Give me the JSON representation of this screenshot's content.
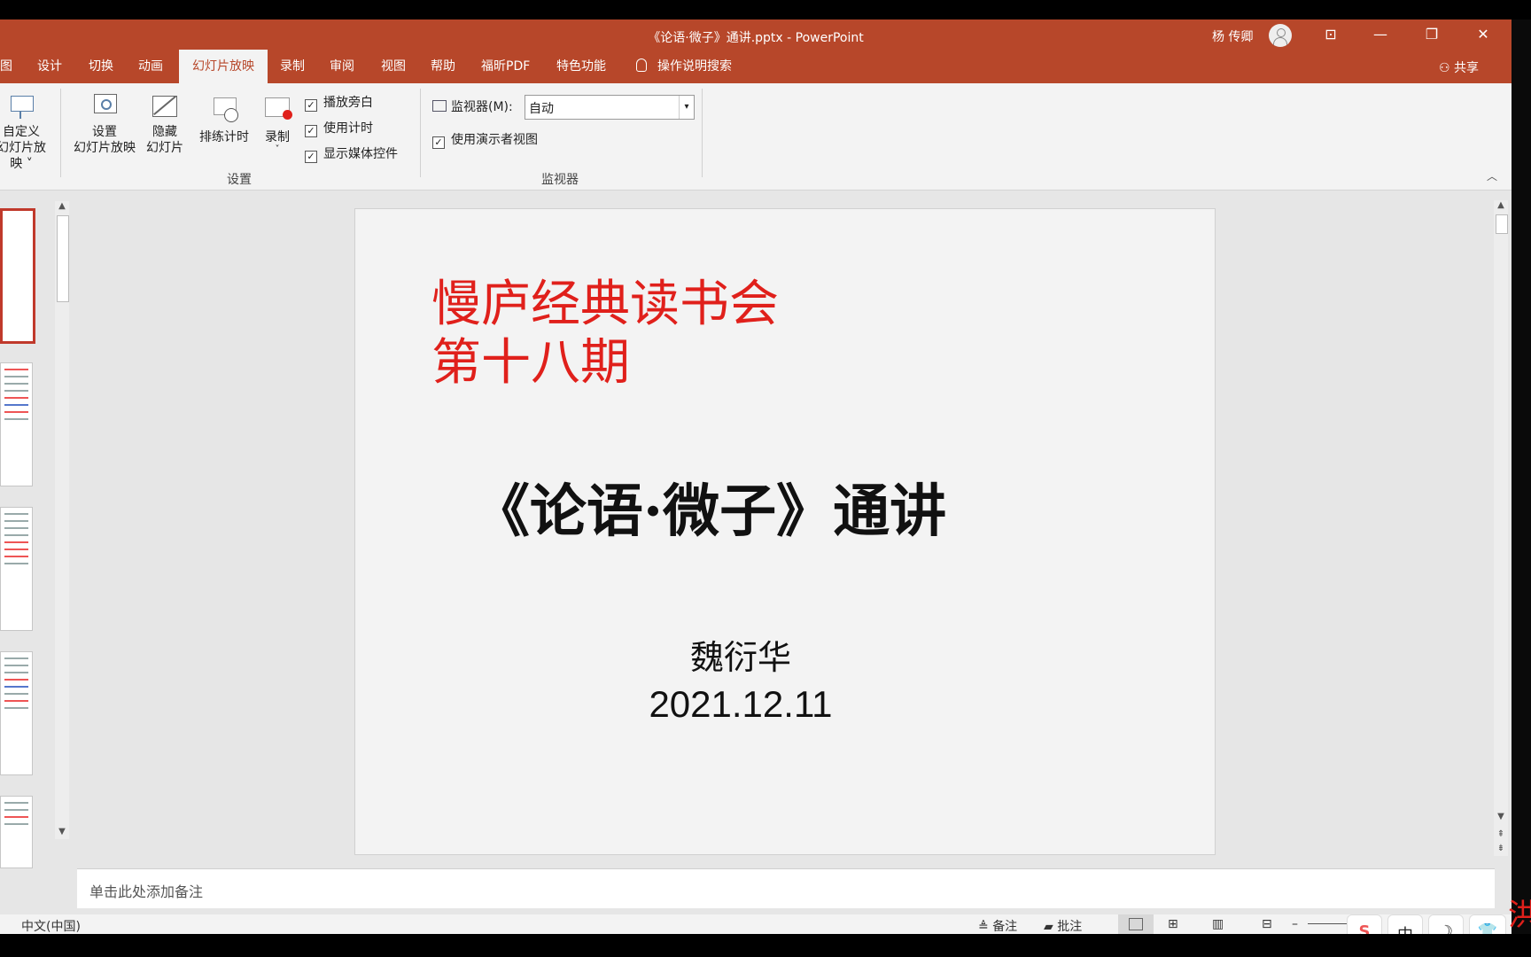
{
  "window": {
    "title": "《论语·微子》通讲.pptx  -  PowerPoint",
    "user": "杨 传卿",
    "controls": {
      "ribbon_display": "⊡",
      "minimize": "—",
      "restore": "❐",
      "close": "✕"
    }
  },
  "tabs": [
    "图",
    "设计",
    "切换",
    "动画",
    "幻灯片放映",
    "录制",
    "审阅",
    "视图",
    "帮助",
    "福昕PDF",
    "特色功能",
    "操作说明搜索"
  ],
  "share_label": "共享",
  "ribbon": {
    "custom_show": {
      "line1": "自定义",
      "line2": "幻灯片放映 ˅"
    },
    "setup": {
      "line1": "设置",
      "line2": "幻灯片放映"
    },
    "hide": {
      "line1": "隐藏",
      "line2": "幻灯片"
    },
    "rehearse": "排练计时",
    "record": {
      "label": "录制",
      "chev": "˅"
    },
    "checks": [
      "播放旁白",
      "使用计时",
      "显示媒体控件"
    ],
    "group_setup": "设置",
    "monitor_label": "监视器(M):",
    "monitor_value": "自动",
    "presenter_view": "使用演示者视图",
    "group_monitor": "监视器",
    "checkmark": "✓"
  },
  "slide": {
    "title_line1": "慢庐经典读书会",
    "title_line2": "第十八期",
    "main_title": "《论语·微子》通讲",
    "author": "魏衍华",
    "date": "2021.12.11"
  },
  "notes_placeholder": "单击此处添加备注",
  "status": {
    "language": "中文(中国)",
    "notes": "备注",
    "comments": "批注"
  },
  "ime": [
    "S",
    "中",
    "☽",
    "👕"
  ],
  "edge_char": "洪"
}
